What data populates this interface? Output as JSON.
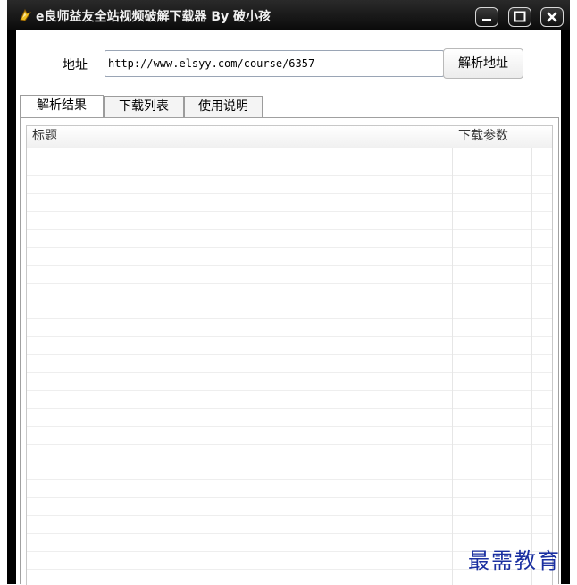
{
  "window": {
    "title": "e良师益友全站视频破解下载器 By 破小孩",
    "icon": "app-icon",
    "controls": [
      "minimize-icon",
      "maximize-icon",
      "close-icon"
    ]
  },
  "address": {
    "label": "地址",
    "value": "http://www.elsyy.com/course/6357",
    "button_label": "解析地址"
  },
  "tabs": [
    {
      "label": "解析结果",
      "active": true
    },
    {
      "label": "下载列表",
      "active": false
    },
    {
      "label": "使用说明",
      "active": false
    }
  ],
  "list": {
    "columns": [
      "标题",
      "下载参数"
    ],
    "rows": []
  },
  "watermark": "最需教育"
}
